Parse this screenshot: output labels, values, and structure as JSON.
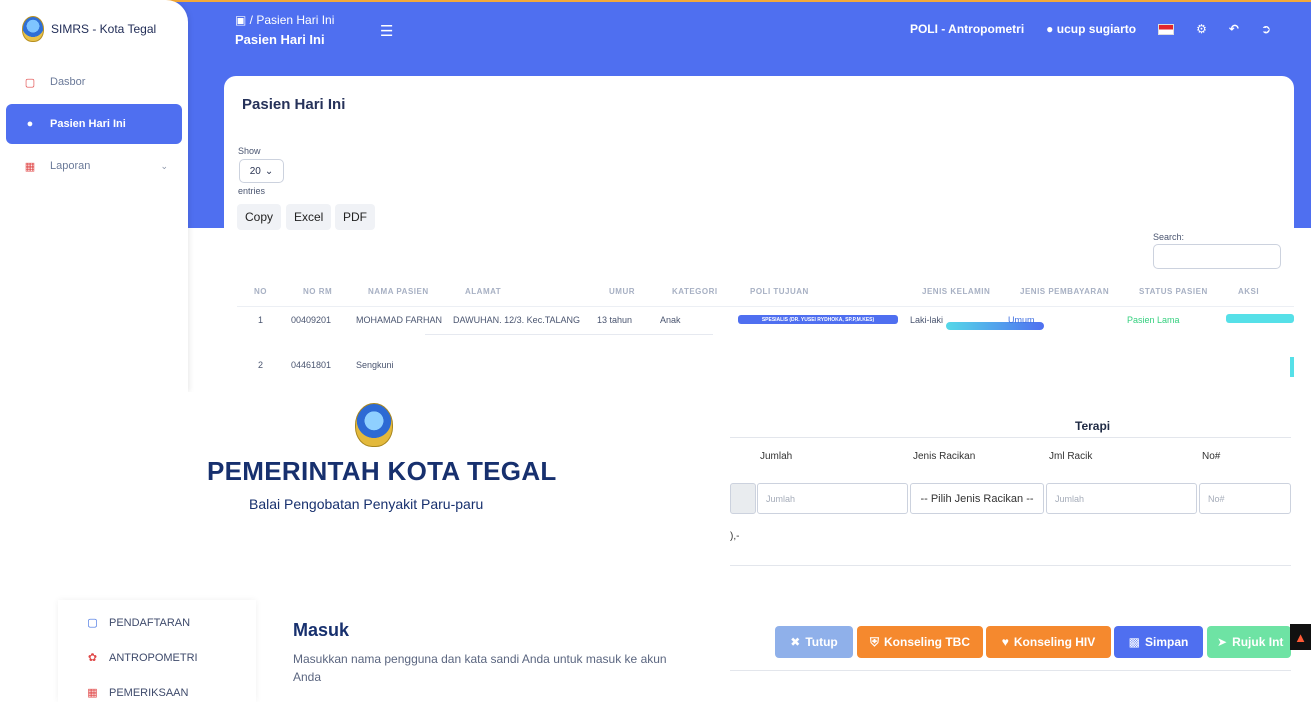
{
  "sidebar": {
    "brand": "SIMRS - Kota Tegal",
    "items": [
      {
        "label": "Dasbor",
        "icon": "monitor-icon"
      },
      {
        "label": "Pasien Hari Ini",
        "icon": "user-icon"
      },
      {
        "label": "Laporan",
        "icon": "report-icon"
      }
    ]
  },
  "header": {
    "breadcrumb": "Pasien Hari Ini",
    "title": "Pasien Hari Ini",
    "poli": "POLI - Antropometri",
    "user": "ucup sugiarto"
  },
  "card": {
    "title": "Pasien Hari Ini",
    "show_label": "Show",
    "entries_value": "20",
    "entries_label": "entries",
    "buttons": [
      "Copy",
      "Excel",
      "PDF"
    ],
    "search_label": "Search:"
  },
  "table": {
    "headers": [
      "NO",
      "NO RM",
      "NAMA PASIEN",
      "ALAMAT",
      "UMUR",
      "KATEGORI",
      "POLI TUJUAN",
      "JENIS KELAMIN",
      "JENIS PEMBAYARAN",
      "STATUS PASIEN",
      "AKSI"
    ],
    "rows": [
      {
        "no": "1",
        "rm": "00409201",
        "nama": "MOHAMAD FARHAN",
        "alamat": "DAWUHAN. 12/3. Kec.TALANG",
        "umur": "13 tahun",
        "kategori": "Anak",
        "poli": "SPESIALIS (DR. YUSEI RYDHOKA, SP.P,M.KES)",
        "jk": "Laki-laki",
        "bayar": "Umum",
        "status": "Pasien Lama"
      },
      {
        "no": "2",
        "rm": "04461801",
        "nama": "Sengkuni"
      }
    ]
  },
  "overlay": {
    "gov_title": "PEMERINTAH KOTA TEGAL",
    "gov_subtitle": "Balai Pengobatan Penyakit Paru-paru",
    "terapi": "Terapi",
    "cols": [
      "Jumlah",
      "Jenis Racikan",
      "Jml Racik",
      "No#"
    ],
    "placeholders": {
      "jumlah": "Jumlah",
      "jml": "Jumlah",
      "no": "No#"
    },
    "select_racikan": "-- Pilih Jenis Racikan --",
    "fragment": "),-",
    "menu": [
      {
        "label": "PENDAFTARAN",
        "icon": "monitor-icon"
      },
      {
        "label": "ANTROPOMETRI",
        "icon": "anthropometry-icon"
      },
      {
        "label": "PEMERIKSAAN",
        "icon": "calendar-icon"
      }
    ],
    "masuk_title": "Masuk",
    "masuk_desc": "Masukkan nama pengguna dan kata sandi Anda untuk masuk ke akun Anda"
  },
  "actions": [
    {
      "label": "Tutup",
      "color": "#8fb0ea",
      "icon": "close-icon"
    },
    {
      "label": "Konseling TBC",
      "color": "#f5892e",
      "icon": "medical-icon"
    },
    {
      "label": "Konseling HIV",
      "color": "#f5892e",
      "icon": "heart-icon"
    },
    {
      "label": "Simpan",
      "color": "#4f6ff0",
      "icon": "save-icon"
    },
    {
      "label": "Rujuk Int",
      "color": "#6ee3a4",
      "icon": "arrow-icon"
    }
  ],
  "colors": {
    "primary": "#4f6ff0",
    "topline": "#f4a93a",
    "success": "#35d07f"
  }
}
